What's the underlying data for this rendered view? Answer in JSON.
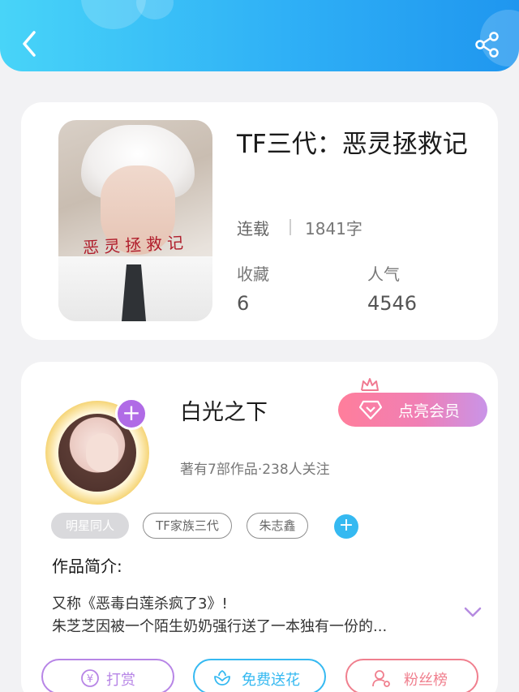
{
  "header": {
    "back_icon": "chevron-left-icon",
    "share_icon": "share-icon"
  },
  "book": {
    "title": "TF三代：恶灵拯救记",
    "cover_text": "恶灵拯救记",
    "status": "连载",
    "word_count": "1841字",
    "favorites_label": "收藏",
    "favorites_value": "6",
    "popularity_label": "人气",
    "popularity_value": "4546"
  },
  "author": {
    "name": "白光之下",
    "meta": "著有7部作品·238人关注",
    "vip_label": "点亮会员"
  },
  "tags": [
    "明星同人",
    "TF家族三代",
    "朱志鑫"
  ],
  "intro": {
    "heading": "作品简介:",
    "line1": "又称《恶毒白莲杀疯了3》!",
    "line2": "朱芝芝因被一个陌生奶奶强行送了一本独有一份的..."
  },
  "actions": {
    "reward": "打赏",
    "flower": "免费送花",
    "fans": "粉丝榜"
  },
  "colors": {
    "header_start": "#48d4f8",
    "header_end": "#1f96ef",
    "reward": "#b785e6",
    "flower": "#35b9f1",
    "fans": "#f07f8e"
  }
}
